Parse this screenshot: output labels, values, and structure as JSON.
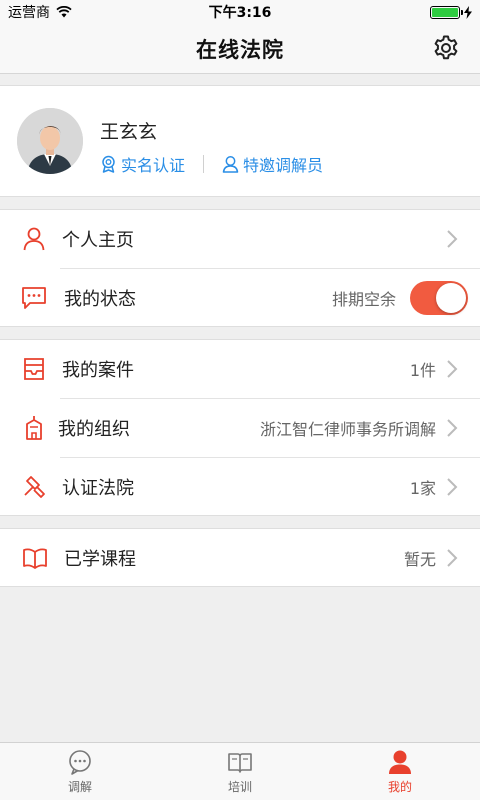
{
  "status_bar": {
    "carrier": "运营商",
    "time": "下午3:16",
    "battery_percent": 100
  },
  "header": {
    "title": "在线法院",
    "settings_icon": "gear-icon"
  },
  "profile": {
    "name": "王玄玄",
    "real_name_label": "实名认证",
    "invited_label": "特邀调解员"
  },
  "menu": {
    "personal_home": {
      "label": "个人主页",
      "icon": "person-icon"
    },
    "my_status": {
      "label": "我的状态",
      "value": "排期空余",
      "toggle_on": true,
      "icon": "chat-icon"
    },
    "my_cases": {
      "label": "我的案件",
      "value": "1件",
      "icon": "inbox-icon"
    },
    "my_org": {
      "label": "我的组织",
      "value": "浙江智仁律师事务所调解",
      "icon": "building-icon"
    },
    "certified_courts": {
      "label": "认证法院",
      "value": "1家",
      "icon": "gavel-icon"
    },
    "courses": {
      "label": "已学课程",
      "value": "暂无",
      "icon": "book-icon"
    }
  },
  "tabbar": {
    "tabs": [
      {
        "label": "调解",
        "icon": "chat-bubbles-icon",
        "active": false
      },
      {
        "label": "培训",
        "icon": "book-open-icon",
        "active": false
      },
      {
        "label": "我的",
        "icon": "user-icon",
        "active": true
      }
    ]
  },
  "colors": {
    "accent": "#f15b40",
    "link_blue": "#2a8ee6",
    "icon_red": "#e8402d"
  }
}
